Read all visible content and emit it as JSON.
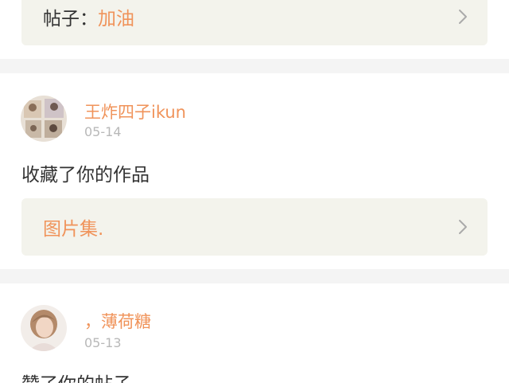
{
  "notifications": [
    {
      "ref_prefix": "帖子：",
      "ref_title": "加油",
      "ref_icon": "chevron-right-icon"
    },
    {
      "username": "王炸四子ikun",
      "date": "05-14",
      "action": "收藏了你的作品",
      "ref_title": "图片集.",
      "ref_icon": "chevron-right-icon",
      "avatar": "user-avatar-photo-collage"
    },
    {
      "username": "，薄荷糖",
      "date": "05-13",
      "action": "赞了你的帖子",
      "avatar": "user-avatar-portrait"
    }
  ],
  "colors": {
    "accent": "#f0935a",
    "date": "#b8b8b8",
    "text": "#333333",
    "ref_box": "#f3f3ec",
    "page_bg": "#f4f4f4"
  }
}
